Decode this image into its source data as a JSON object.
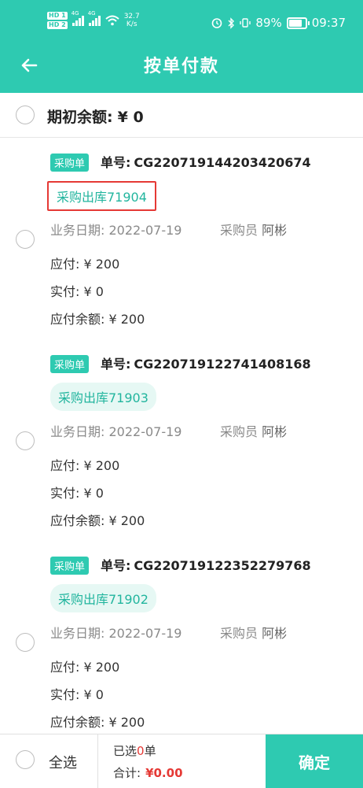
{
  "status_bar": {
    "hd1": "HD 1",
    "hd2": "HD 2",
    "net1": "4G",
    "net2": "4G",
    "speed_value": "32.7",
    "speed_unit": "K/s",
    "battery": "89%",
    "battery_level": 0.89,
    "time": "09:37"
  },
  "header": {
    "title": "按单付款",
    "back_icon": "arrow-left-icon"
  },
  "opening_balance": {
    "label": "期初余额:",
    "value": "¥ 0"
  },
  "orders": [
    {
      "tag": "采购单",
      "no_label": "单号:",
      "no": "CG220719144203420674",
      "chip": "采购出库71904",
      "highlight": true,
      "date_label": "业务日期:",
      "date": "2022-07-19",
      "buyer_label": "采购员",
      "buyer": "阿彬",
      "payable": "应付: ¥ 200",
      "paid": "实付: ¥ 0",
      "balance": "应付余额: ¥ 200"
    },
    {
      "tag": "采购单",
      "no_label": "单号:",
      "no": "CG220719122741408168",
      "chip": "采购出库71903",
      "highlight": false,
      "date_label": "业务日期:",
      "date": "2022-07-19",
      "buyer_label": "采购员",
      "buyer": "阿彬",
      "payable": "应付: ¥ 200",
      "paid": "实付: ¥ 0",
      "balance": "应付余额: ¥ 200"
    },
    {
      "tag": "采购单",
      "no_label": "单号:",
      "no": "CG220719122352279768",
      "chip": "采购出库71902",
      "highlight": false,
      "date_label": "业务日期:",
      "date": "2022-07-19",
      "buyer_label": "采购员",
      "buyer": "阿彬",
      "payable": "应付: ¥ 200",
      "paid": "实付: ¥ 0",
      "balance": "应付余额: ¥ 200"
    }
  ],
  "footer": {
    "select_all": "全选",
    "selected_prefix": "已选",
    "selected_count": "0",
    "selected_suffix": "单",
    "total_label": "合计:",
    "total_value": "¥0.00",
    "confirm": "确定"
  },
  "colors": {
    "primary": "#2ecab1",
    "accent_red": "#e53935",
    "chip_bg": "#e6f8f4"
  }
}
